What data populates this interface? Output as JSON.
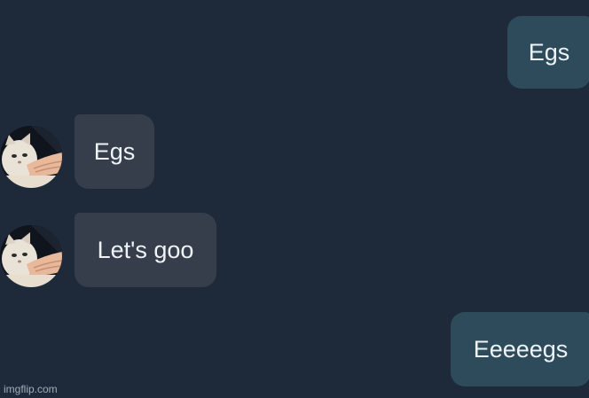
{
  "messages": [
    {
      "direction": "outgoing",
      "text": "Egs"
    },
    {
      "direction": "incoming",
      "text": "Egs"
    },
    {
      "direction": "incoming",
      "text": "Let's goo"
    },
    {
      "direction": "outgoing",
      "text": "Eeeeegs"
    }
  ],
  "watermark": "imgflip.com",
  "colors": {
    "background": "#1e2a3a",
    "outgoing_bubble": "#2e4b5c",
    "incoming_bubble": "#363e4c",
    "text": "#eef3f6"
  },
  "icons": {
    "avatar": "cat-avatar"
  }
}
